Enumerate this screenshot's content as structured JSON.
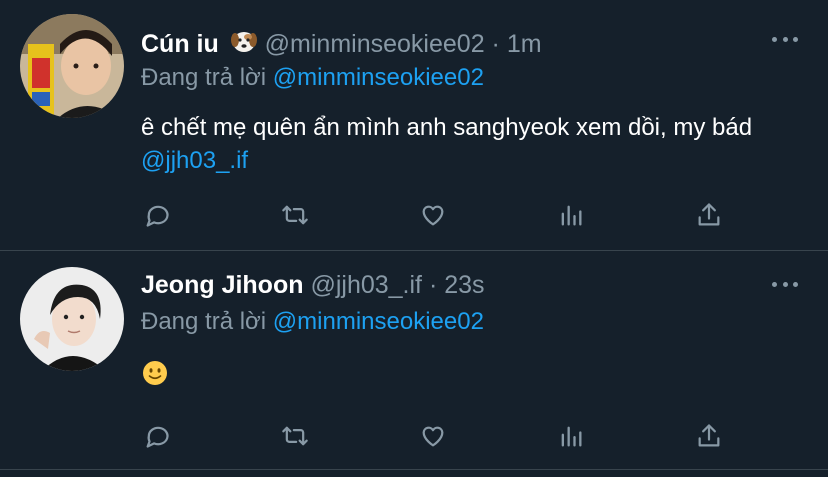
{
  "tweets": [
    {
      "name": "Cún iu",
      "badge_icon": "dog-face-emoji",
      "handle": "@minminseokiee02",
      "separator": "·",
      "time": "1m",
      "reply_prefix": "Đang trả lời",
      "reply_to": "@minminseokiee02",
      "text": "ê chết mẹ quên ẩn mình anh sanghyeok xem dồi, my bád",
      "text_mention": "@jjh03_.if"
    },
    {
      "name": "Jeong Jihoon",
      "handle": "@jjh03_.if",
      "separator": "·",
      "time": "23s",
      "reply_prefix": "Đang trả lời",
      "reply_to": "@minminseokiee02",
      "text_emoji": "slightly-smiling-face-emoji"
    }
  ],
  "colors": {
    "background": "#15202b",
    "secondary_text": "#8899a6",
    "link": "#1da1f2",
    "divider": "#38444d"
  },
  "action_icons": [
    "reply-icon",
    "retweet-icon",
    "like-icon",
    "analytics-icon",
    "share-icon"
  ]
}
